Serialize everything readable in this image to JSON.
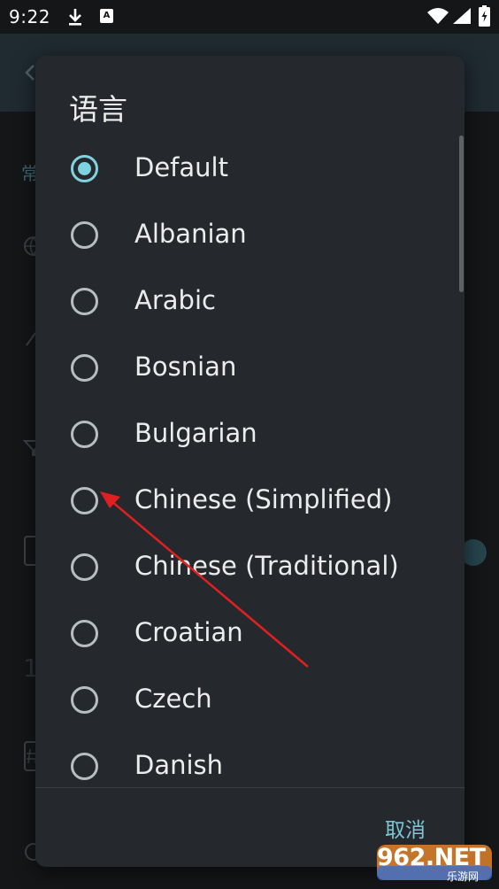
{
  "status_bar": {
    "time": "9:22",
    "icons": [
      "download-icon",
      "a-notification-icon",
      "wifi-icon",
      "signal-icon",
      "battery-icon"
    ]
  },
  "background_app": {
    "section_char": "常",
    "digit": "1"
  },
  "dialog": {
    "title": "语言",
    "options": [
      {
        "label": "Default",
        "selected": true
      },
      {
        "label": "Albanian",
        "selected": false
      },
      {
        "label": "Arabic",
        "selected": false
      },
      {
        "label": "Bosnian",
        "selected": false
      },
      {
        "label": "Bulgarian",
        "selected": false
      },
      {
        "label": "Chinese (Simplified)",
        "selected": false
      },
      {
        "label": "Chinese (Traditional)",
        "selected": false
      },
      {
        "label": "Croatian",
        "selected": false
      },
      {
        "label": "Czech",
        "selected": false
      },
      {
        "label": "Danish",
        "selected": false
      }
    ],
    "cancel_label": "取消"
  },
  "colors": {
    "accent": "#7fd3df",
    "dialog_bg": "#25292d",
    "annotation_arrow": "#e02020"
  },
  "watermark": {
    "text": "962.NET",
    "sub": "乐游网"
  }
}
